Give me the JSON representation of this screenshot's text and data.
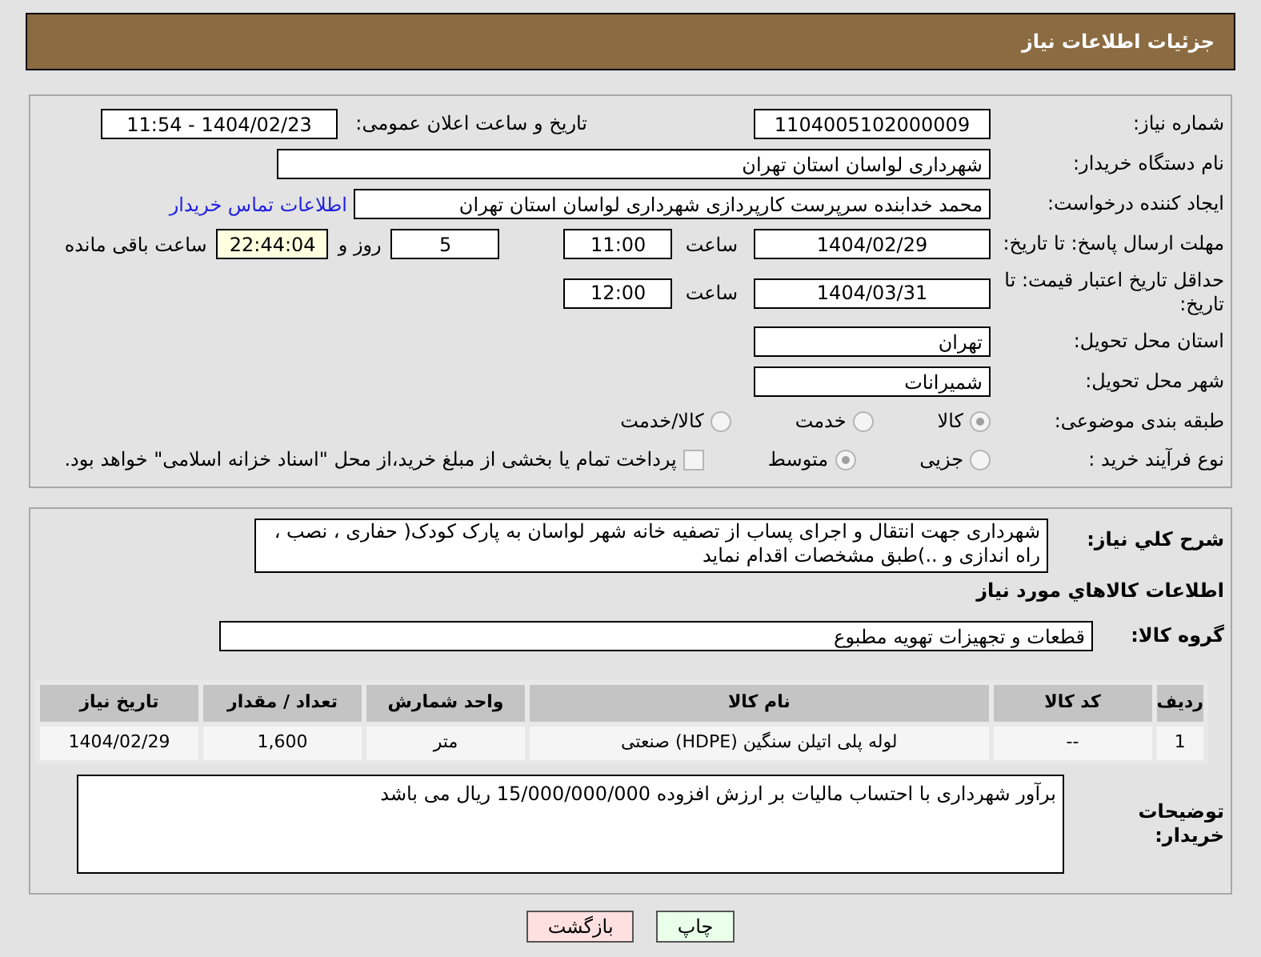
{
  "header": {
    "title": "جزئیات اطلاعات نیاز"
  },
  "need_number": {
    "label": "شماره نیاز:",
    "value": "1104005102000009"
  },
  "announce": {
    "label": "تاریخ و ساعت اعلان عمومی:",
    "value": "1404/02/23 - 11:54"
  },
  "buyer_org": {
    "label": "نام دستگاه خریدار:",
    "value": "شهرداری لواسان استان تهران"
  },
  "requester": {
    "label": "ایجاد کننده درخواست:",
    "value": "محمد خدابنده سرپرست کارپردازی شهرداری لواسان استان تهران",
    "link": "اطلاعات تماس خریدار"
  },
  "reply_deadline": {
    "label": "مهلت ارسال پاسخ: تا تاریخ:",
    "date": "1404/02/29",
    "time_label": "ساعت",
    "time": "11:00",
    "days": "5",
    "days_label": "روز و",
    "remaining": "22:44:04",
    "remaining_label": "ساعت باقی مانده"
  },
  "price_validity": {
    "label": "حداقل تاریخ اعتبار قیمت: تا تاریخ:",
    "date": "1404/03/31",
    "time_label": "ساعت",
    "time": "12:00"
  },
  "province": {
    "label": "استان محل تحویل:",
    "value": "تهران"
  },
  "city": {
    "label": "شهر محل تحویل:",
    "value": "شمیرانات"
  },
  "category": {
    "label": "طبقه بندی موضوعی:",
    "options": [
      {
        "label": "کالا",
        "selected": true
      },
      {
        "label": "خدمت",
        "selected": false
      },
      {
        "label": "کالا/خدمت",
        "selected": false
      }
    ]
  },
  "process": {
    "label": "نوع فرآیند خرید :",
    "options": [
      {
        "label": "جزیی",
        "selected": false
      },
      {
        "label": "متوسط",
        "selected": true
      }
    ],
    "payment": {
      "label": "پرداخت تمام یا بخشی از مبلغ خرید،از محل \"اسناد خزانه اسلامی\" خواهد بود.",
      "checked": false
    }
  },
  "description": {
    "label": "شرح کلي نیاز:",
    "value": "شهرداری جهت انتقال و اجرای پساب از تصفیه خانه شهر لواسان به پارک کودک( حفاری ، نصب ، راه اندازی و ..)طبق مشخصات اقدام نماید"
  },
  "goods": {
    "title": "اطلاعات کالاهاي مورد نیاز",
    "group": {
      "label": "گروه کالا:",
      "value": "قطعات و تجهیزات تهویه مطبوع"
    },
    "table": {
      "columns": [
        "ردیف",
        "کد کالا",
        "نام کالا",
        "واحد شمارش",
        "تعداد / مقدار",
        "تاریخ نیاز"
      ],
      "rows": [
        [
          "1",
          "--",
          "لوله پلی اتیلن سنگین (HDPE) صنعتی",
          "متر",
          "1,600",
          "1404/02/29"
        ]
      ]
    }
  },
  "buyer_notes": {
    "label": "توضیحات خریدار:",
    "value": "برآور شهرداری با احتساب مالیات بر ارزش افزوده 15/000/000/000 ریال می باشد"
  },
  "buttons": [
    {
      "label": "چاپ",
      "kind": "print"
    },
    {
      "label": "بازگشت",
      "kind": "back"
    }
  ]
}
